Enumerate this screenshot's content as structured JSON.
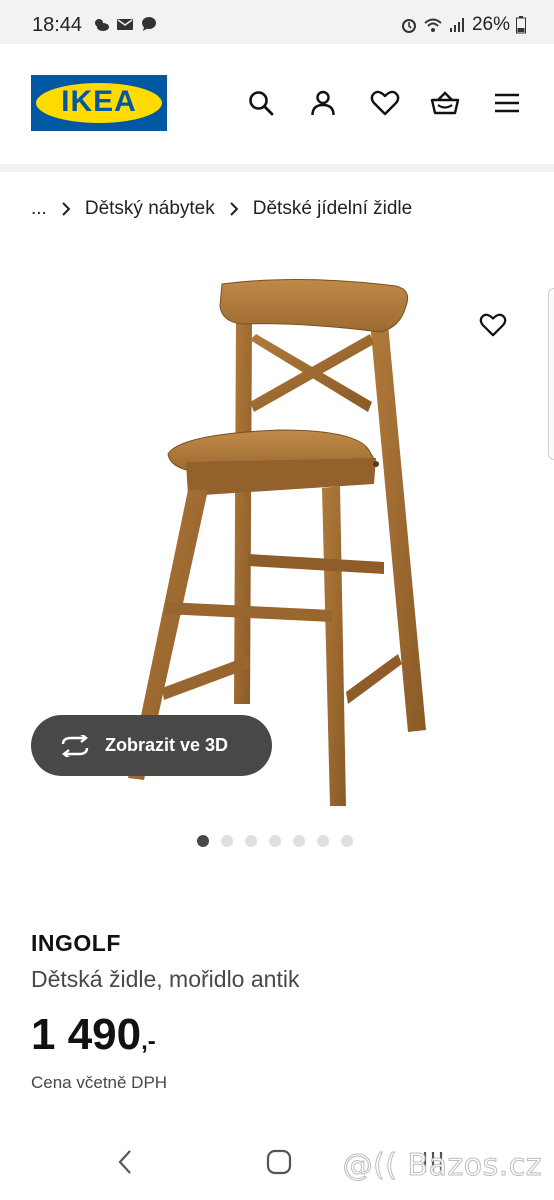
{
  "status_bar": {
    "time": "18:44",
    "battery": "26%",
    "icons": [
      "weather-icon",
      "mail-icon",
      "chat-icon",
      "alarm-icon",
      "wifi-icon",
      "signal-icon",
      "battery-icon"
    ]
  },
  "header": {
    "logo_text": "IKEA",
    "icons": [
      "search-icon",
      "account-icon",
      "heart-icon",
      "cart-icon",
      "menu-icon"
    ],
    "brand_blue": "#0058a3",
    "brand_yellow": "#ffdb00"
  },
  "breadcrumb": {
    "ellipsis": "...",
    "items": [
      "Dětský nábytek",
      "Dětské jídelní židle"
    ]
  },
  "gallery": {
    "image_count": 7,
    "active_index": 0,
    "view_3d_label": "Zobrazit ve 3D"
  },
  "product": {
    "name": "INGOLF",
    "description": "Dětská židle, mořidlo antik",
    "price": "1 490",
    "price_suffix": ",-",
    "vat_note": "Cena včetně DPH"
  },
  "navigation": {
    "icons": [
      "back-icon",
      "home-icon",
      "recents-icon"
    ]
  },
  "watermark": "@(( Bazos.cz"
}
